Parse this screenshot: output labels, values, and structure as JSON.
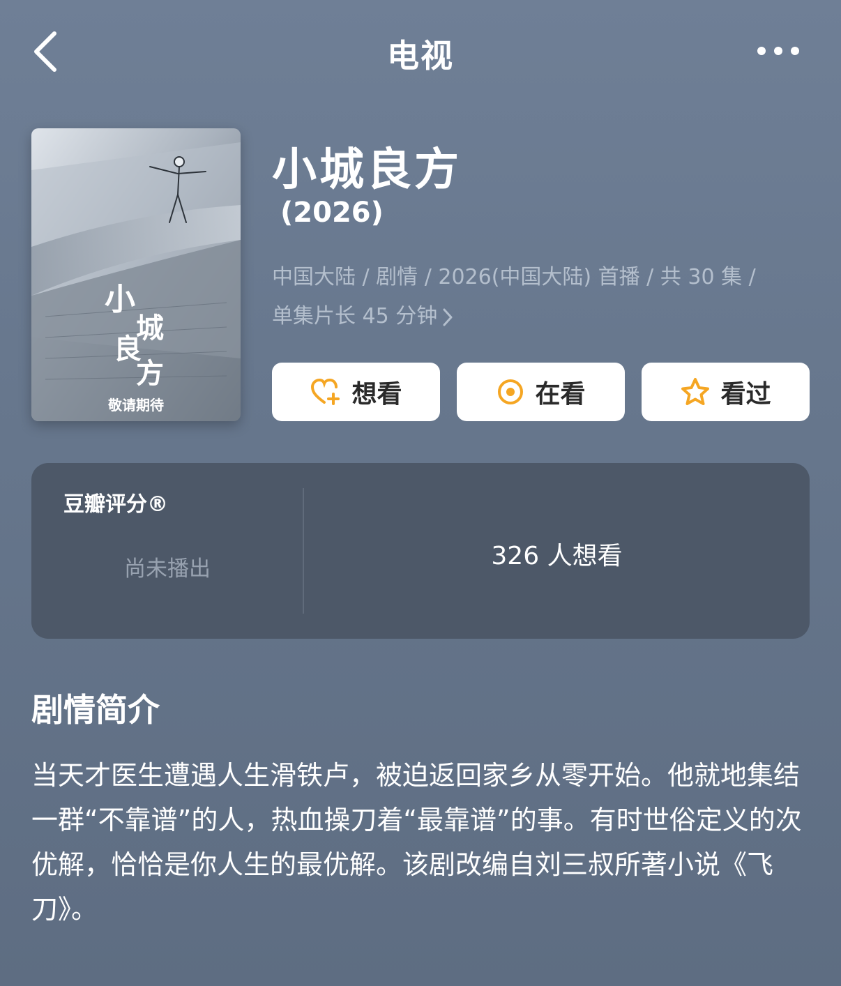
{
  "nav": {
    "title": "电视"
  },
  "poster": {
    "tagline": "敬请期待"
  },
  "show": {
    "title": "小城良方",
    "year": "(2026)",
    "meta_line1": "中国大陆 / 剧情 / 2026(中国大陆) 首播 / 共 30 集 /",
    "meta_line2": "单集片长 45 分钟"
  },
  "actions": {
    "want_label": "想看",
    "watching_label": "在看",
    "watched_label": "看过"
  },
  "rating": {
    "label": "豆瓣评分®",
    "status": "尚未播出",
    "want_count": "326 人想看"
  },
  "synopsis": {
    "title": "剧情简介",
    "text": "当天才医生遭遇人生滑铁卢，被迫返回家乡从零开始。他就地集结一群“不靠谱”的人，热血操刀着“最靠谱”的事。有时世俗定义的次优解，恰恰是你人生的最优解。该剧改编自刘三叔所著小说《飞刀》。"
  },
  "colors": {
    "accent": "#f5a623",
    "background": "#6a7a90",
    "card": "#4d5868"
  }
}
